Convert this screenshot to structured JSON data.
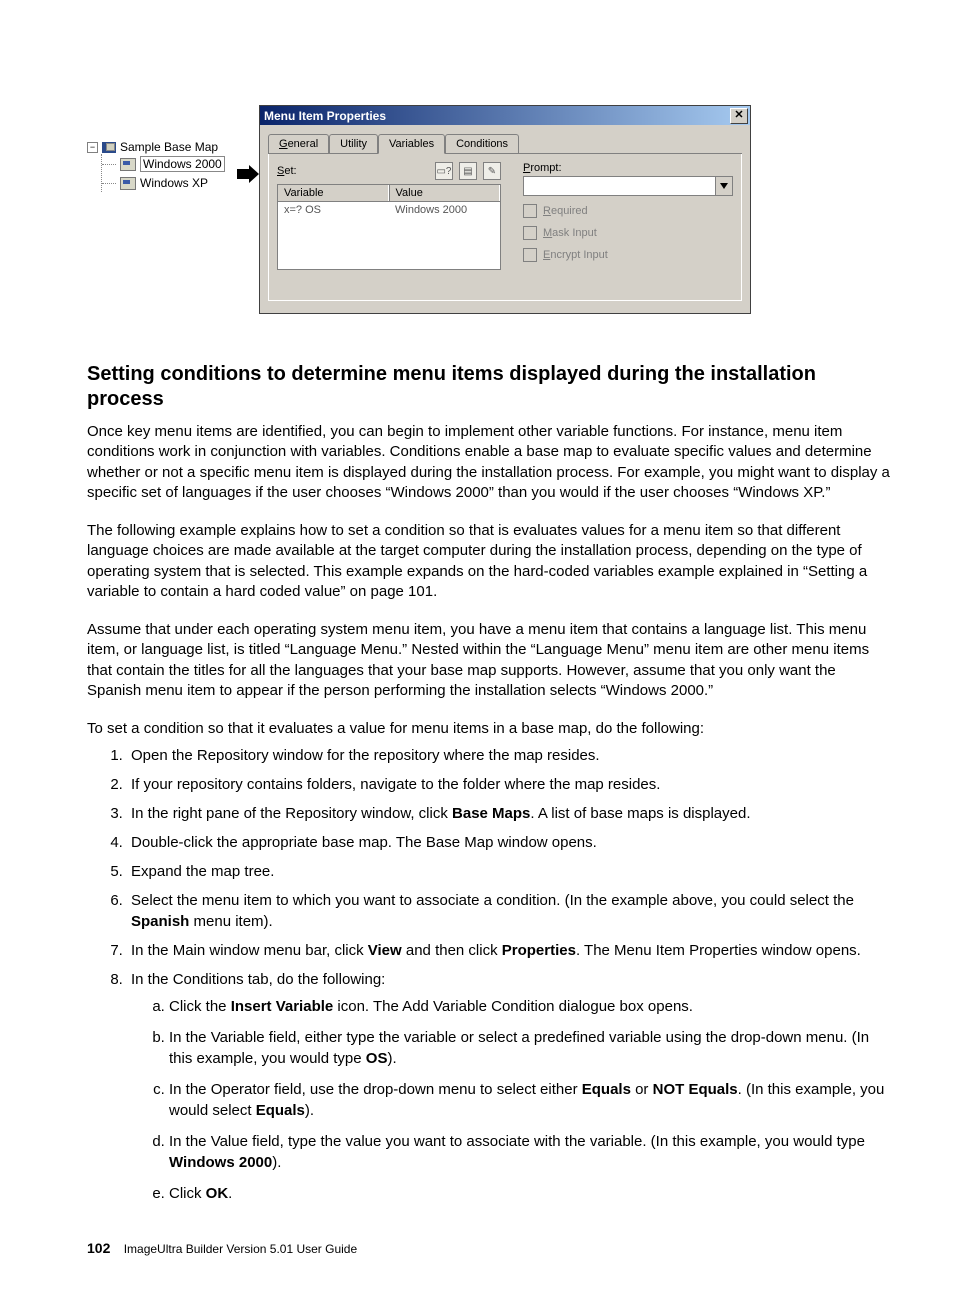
{
  "tree": {
    "root": "Sample Base Map",
    "items": [
      "Windows 2000",
      "Windows XP"
    ]
  },
  "dialog": {
    "title": "Menu Item Properties",
    "tabs": {
      "general": "General",
      "utility": "Utility",
      "variables": "Variables",
      "conditions": "Conditions"
    },
    "set_label": "Set:",
    "grid_head": {
      "variable": "Variable",
      "value": "Value"
    },
    "grid_row": {
      "variable": "x=? OS",
      "value": "Windows 2000"
    },
    "prompt_label": "Prompt:",
    "checks": {
      "required": "Required",
      "mask": "Mask Input",
      "encrypt": "Encrypt Input"
    }
  },
  "section_heading": "Setting conditions to determine menu items displayed during the installation process",
  "para1": "Once key menu items are identified, you can begin to implement other variable functions. For instance, menu item conditions work in conjunction with variables. Conditions enable a base map to evaluate specific values and determine whether or not a specific menu item is displayed during the installation process. For example, you might want to display a specific set of languages if the user chooses “Windows 2000” than you would if the user chooses “Windows XP.”",
  "para2": "The following example explains how to set a condition so that is evaluates values for a menu item so that different language choices are made available at the target computer during the installation process, depending on the type of operating system that is selected. This example expands on the hard-coded variables example explained in “Setting a variable to contain a hard coded value” on page 101.",
  "para3": "Assume that under each operating system menu item, you have a menu item that contains a language list. This menu item, or language list, is titled “Language Menu.” Nested within the “Language Menu” menu item are other menu items that contain the titles for all the languages that your base map supports. However, assume that you only want the Spanish menu item to appear if the person performing the installation selects “Windows 2000.”",
  "para4": "To set a condition so that it evaluates a value for menu items in a base map, do the following:",
  "steps": {
    "s1": "Open the Repository window for the repository where the map resides.",
    "s2": "If your repository contains folders, navigate to the folder where the map resides.",
    "s3a": "In the right pane of the Repository window, click ",
    "s3b": "Base Maps",
    "s3c": ". A list of base maps is displayed.",
    "s4": "Double-click the appropriate base map. The Base Map window opens.",
    "s5": "Expand the map tree.",
    "s6a": "Select the menu item to which you want to associate a condition. (In the example above, you could select the ",
    "s6b": "Spanish",
    "s6c": " menu item).",
    "s7a": "In the Main window menu bar, click ",
    "s7b": "View",
    "s7c": " and then click ",
    "s7d": "Properties",
    "s7e": ". The Menu Item Properties window opens.",
    "s8": "In the Conditions tab, do the following:",
    "a_a1": "Click the ",
    "a_a2": "Insert Variable",
    "a_a3": " icon. The Add Variable Condition dialogue box opens.",
    "a_b1": "In the Variable field, either type the variable or select a predefined variable using the drop-down menu. (In this example, you would type ",
    "a_b2": "OS",
    "a_b3": ").",
    "a_c1": "In the Operator field, use the drop-down menu to select either ",
    "a_c2": "Equals",
    "a_c3": " or ",
    "a_c4": "NOT Equals",
    "a_c5": ". (In this example, you would select ",
    "a_c6": "Equals",
    "a_c7": ").",
    "a_d1": "In the Value field, type the value you want to associate with the variable. (In this example, you would type ",
    "a_d2": "Windows 2000",
    "a_d3": ").",
    "a_e1": "Click ",
    "a_e2": "OK",
    "a_e3": "."
  },
  "footer": {
    "page": "102",
    "text": "ImageUltra Builder Version 5.01 User Guide"
  }
}
